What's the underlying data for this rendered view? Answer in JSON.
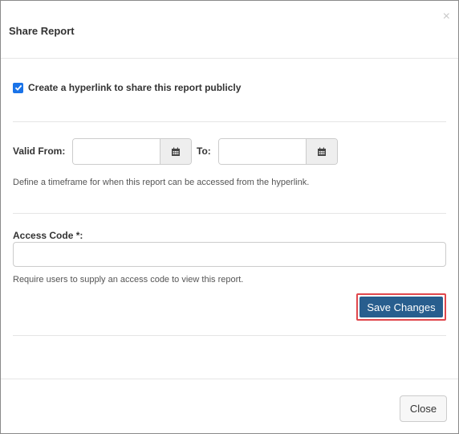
{
  "modal": {
    "title": "Share Report",
    "close_glyph": "×"
  },
  "share_public": {
    "checked": true,
    "label": "Create a hyperlink to share this report publicly"
  },
  "timeframe": {
    "valid_from_label": "Valid From:",
    "valid_from_value": "",
    "to_label": "To:",
    "to_value": "",
    "calendar_icon": "calendar-icon",
    "help": "Define a timeframe for when this report can be accessed from the hyperlink."
  },
  "access_code": {
    "label": "Access Code *:",
    "value": "",
    "help": "Require users to supply an access code to view this report."
  },
  "actions": {
    "save_label": "Save Changes",
    "close_label": "Close"
  },
  "colors": {
    "primary": "#285e8e",
    "highlight_border": "#e0474c",
    "checkbox": "#1a73e8"
  }
}
